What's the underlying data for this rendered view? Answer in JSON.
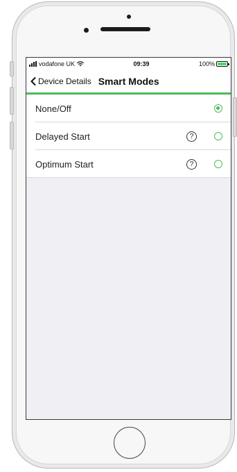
{
  "status_bar": {
    "carrier": "vodafone UK",
    "time": "09:39",
    "battery": "100%"
  },
  "nav": {
    "back_label": "Device Details",
    "title": "Smart Modes"
  },
  "modes": [
    {
      "label": "None/Off",
      "selected": true,
      "has_help": false
    },
    {
      "label": "Delayed Start",
      "selected": false,
      "has_help": true,
      "help_glyph": "?"
    },
    {
      "label": "Optimum Start",
      "selected": false,
      "has_help": true,
      "help_glyph": "?"
    }
  ],
  "colors": {
    "accent": "#4cbb5a",
    "background": "#efeff4"
  }
}
